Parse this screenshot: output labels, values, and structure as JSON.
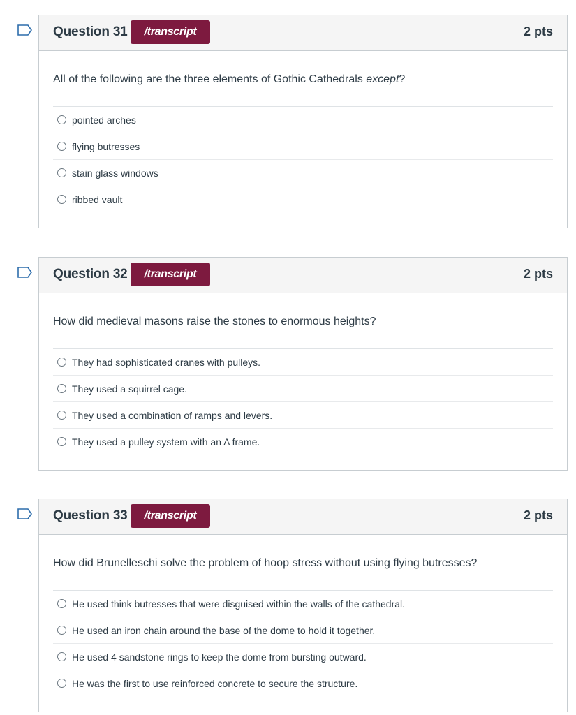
{
  "questions": [
    {
      "title": "Question 31",
      "transcript_label": "/transcript",
      "points": "2 pts",
      "text_main": "All of the following are the three elements of Gothic Cathedrals ",
      "text_emph": "except",
      "text_end": "?",
      "answers": [
        "pointed arches",
        "flying butresses",
        "stain glass windows",
        "ribbed vault"
      ]
    },
    {
      "title": "Question 32",
      "transcript_label": "/transcript",
      "points": "2 pts",
      "text_main": "How did medieval masons raise the stones to enormous heights?",
      "text_emph": "",
      "text_end": "",
      "answers": [
        "They had sophisticated cranes with pulleys.",
        "They used a squirrel cage.",
        "They used a combination of ramps and levers.",
        "They used a pulley system with an A frame."
      ]
    },
    {
      "title": "Question 33",
      "transcript_label": "/transcript",
      "points": "2 pts",
      "text_main": "How did Brunelleschi solve the problem of hoop stress without using flying butresses?",
      "text_emph": "",
      "text_end": "",
      "answers": [
        "He used think butresses that were disguised within the walls of the cathedral.",
        "He used an iron chain around the base of the dome to hold it together.",
        "He used 4 sandstone rings to keep the dome from bursting outward.",
        "He was the first to use reinforced concrete to secure the structure."
      ]
    }
  ],
  "colors": {
    "transcript_bg": "#7d1a3f",
    "flag_outline": "#2d6dac",
    "header_bg": "#f5f5f5"
  },
  "icons": {
    "flag": "flag-bookmark-icon",
    "radio": "radio-unchecked"
  }
}
